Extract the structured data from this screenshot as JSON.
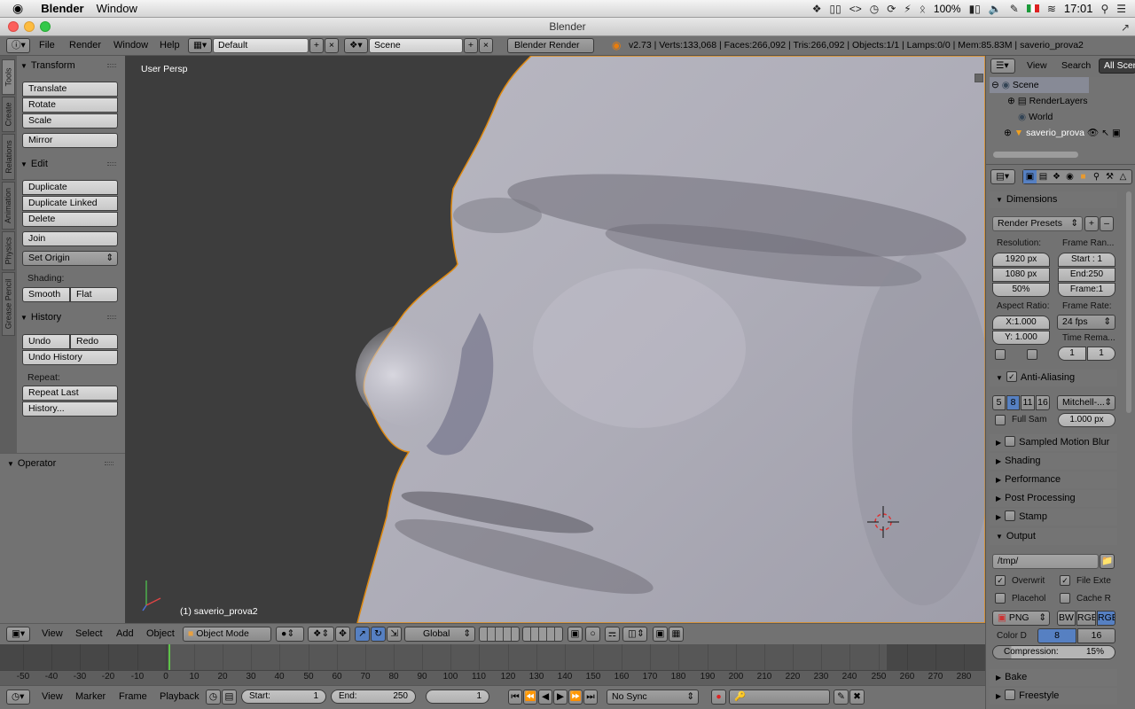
{
  "mac_menubar": {
    "app": "Blender",
    "menu": "Window",
    "battery": "100%",
    "clock": "17:01"
  },
  "window_title": "Blender",
  "info_header": {
    "menus": [
      "File",
      "Render",
      "Window",
      "Help"
    ],
    "layout": "Default",
    "scene": "Scene",
    "engine": "Blender Render",
    "stats": "v2.73 | Verts:133,068 | Faces:266,092 | Tris:266,092 | Objects:1/1 | Lamps:0/0 | Mem:85.83M | saverio_prova2"
  },
  "tool_tabs": [
    "Tools",
    "Create",
    "Relations",
    "Animation",
    "Physics",
    "Grease Pencil"
  ],
  "tools_panel": {
    "transform": {
      "title": "Transform",
      "buttons": [
        "Translate",
        "Rotate",
        "Scale",
        "Mirror"
      ]
    },
    "edit": {
      "title": "Edit",
      "buttons": [
        "Duplicate",
        "Duplicate Linked",
        "Delete",
        "Join"
      ],
      "set_origin": "Set Origin",
      "shading_label": "Shading:",
      "smooth": "Smooth",
      "flat": "Flat"
    },
    "history": {
      "title": "History",
      "undo": "Undo",
      "redo": "Redo",
      "undo_history": "Undo History",
      "repeat_label": "Repeat:",
      "repeat_last": "Repeat Last",
      "history_btn": "History..."
    }
  },
  "operator_panel": {
    "title": "Operator"
  },
  "viewport": {
    "view_name": "User Persp",
    "object_label": "(1) saverio_prova2"
  },
  "view3d_header": {
    "menus": [
      "View",
      "Select",
      "Add",
      "Object"
    ],
    "mode": "Object Mode",
    "orientation": "Global"
  },
  "timeline": {
    "ticks": [
      "-50",
      "-40",
      "-30",
      "-20",
      "-10",
      "0",
      "10",
      "20",
      "30",
      "40",
      "50",
      "60",
      "70",
      "80",
      "90",
      "100",
      "110",
      "120",
      "130",
      "140",
      "150",
      "160",
      "170",
      "180",
      "190",
      "200",
      "210",
      "220",
      "230",
      "240",
      "250",
      "260",
      "270",
      "280"
    ],
    "current_frame": 1,
    "menus": [
      "View",
      "Marker",
      "Frame",
      "Playback"
    ],
    "start_label": "Start:",
    "start": "1",
    "end_label": "End:",
    "end": "250",
    "frame": "1",
    "sync": "No Sync"
  },
  "outliner": {
    "view": "View",
    "search": "Search",
    "filter": "All Scen",
    "items": [
      "Scene",
      "RenderLayers",
      "World",
      "saverio_prova"
    ]
  },
  "properties": {
    "dimensions": {
      "title": "Dimensions",
      "presets": "Render Presets",
      "resolution_label": "Resolution:",
      "res_x": "1920 px",
      "res_y": "1080 px",
      "res_pct": "50%",
      "frame_range_label": "Frame Ran...",
      "start": "Start : 1",
      "end": "End:250",
      "step": "Frame:1",
      "aspect_label": "Aspect Ratio:",
      "aspect_x": "X:1.000",
      "aspect_y": "Y: 1.000",
      "frame_rate_label": "Frame Rate:",
      "fps": "24 fps",
      "time_remap_label": "Time Rema...",
      "remap_old": "1",
      "remap_new": "1"
    },
    "anti_aliasing": {
      "title": "Anti-Aliasing",
      "samples": [
        "5",
        "8",
        "11",
        "16"
      ],
      "filter": "Mitchell-...",
      "full_sample": "Full Sam",
      "filter_size": "1.000 px"
    },
    "collapsed": [
      "Sampled Motion Blur",
      "Shading",
      "Performance",
      "Post Processing",
      "Stamp"
    ],
    "output": {
      "title": "Output",
      "path": "/tmp/",
      "overwrite": "Overwrit",
      "file_ext": "File Exte",
      "placeholders": "Placehol",
      "cache": "Cache R",
      "format": "PNG",
      "bw": "BW",
      "rgb": "RGB",
      "rgba": "RGB",
      "color_depth_label": "Color D",
      "depth_8": "8",
      "depth_16": "16",
      "compression": "Compression:",
      "compression_value": "15%"
    },
    "bottom_sections": [
      "Bake",
      "Freestyle"
    ]
  }
}
